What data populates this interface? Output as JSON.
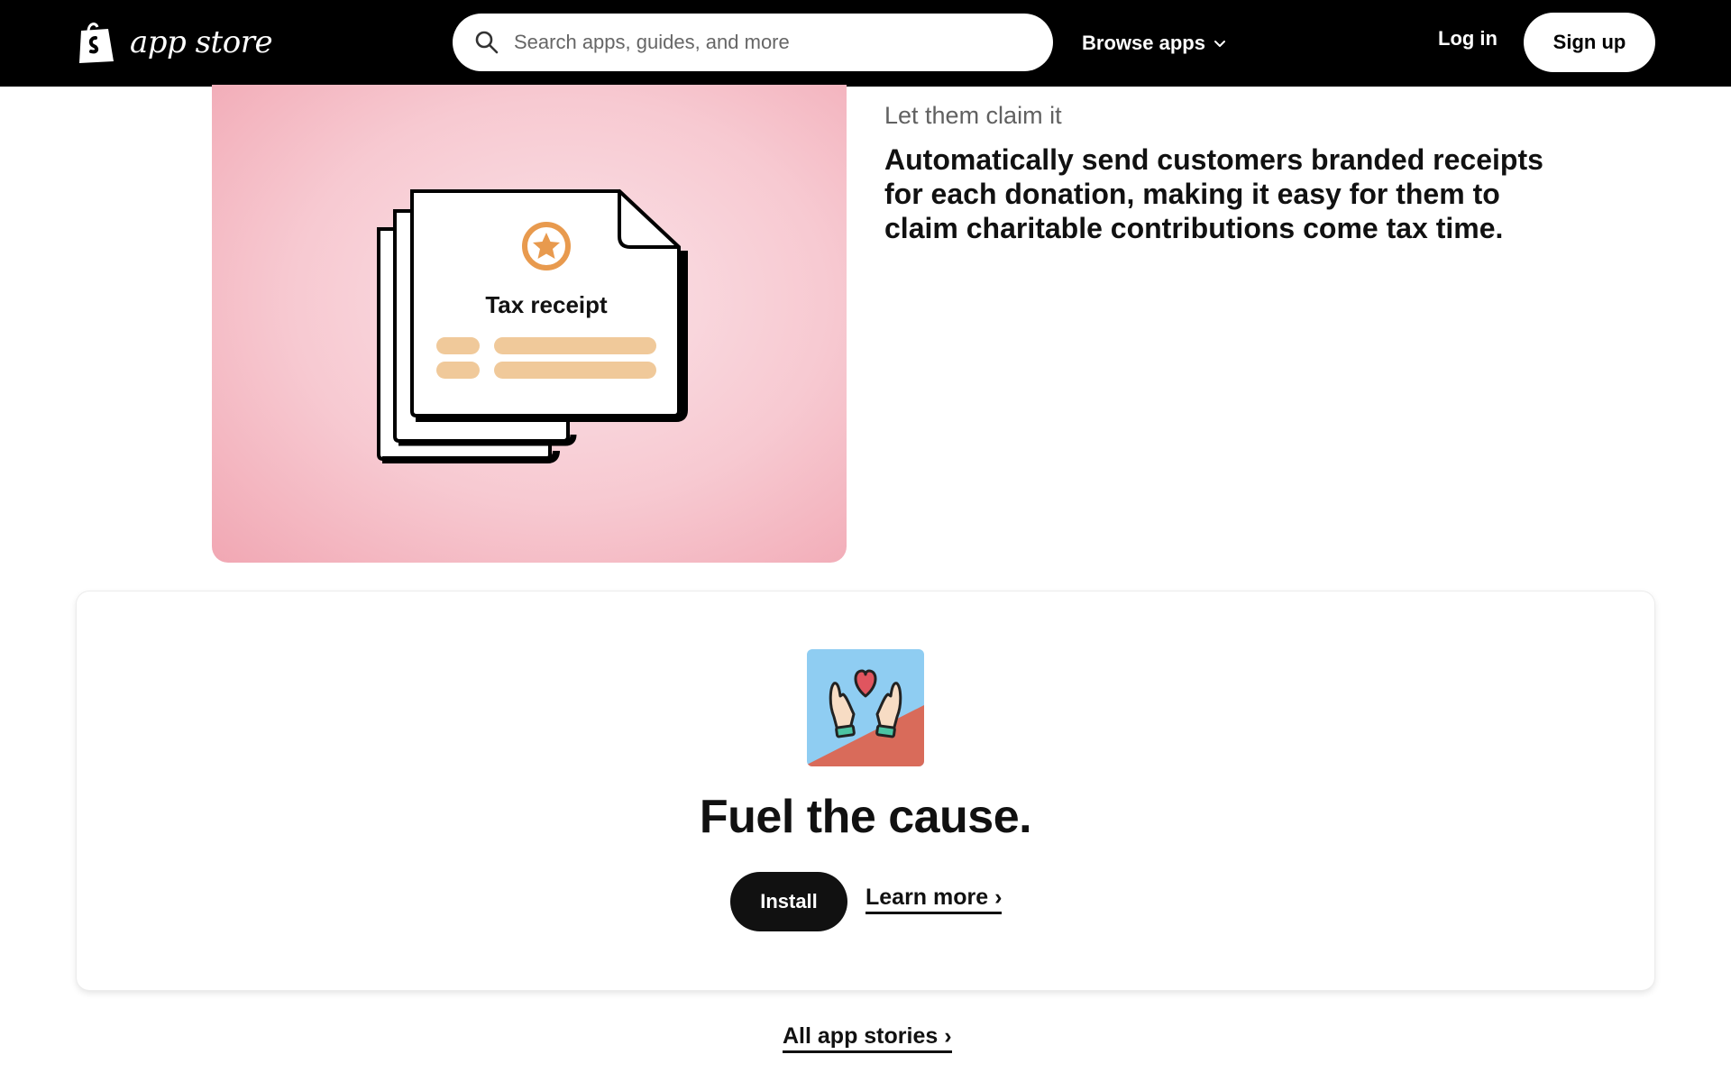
{
  "header": {
    "logo_text": "app store",
    "search_placeholder": "Search apps, guides, and more",
    "browse_label": "Browse apps",
    "login_label": "Log in",
    "signup_label": "Sign up"
  },
  "feature": {
    "illustration_label": "Tax receipt",
    "eyebrow": "Let them claim it",
    "heading": "Automatically send customers branded receipts for each donation, making it easy for them to claim charitable contributions come tax time."
  },
  "cta": {
    "title": "Fuel the cause.",
    "install_label": "Install",
    "learn_more_label": "Learn more ›"
  },
  "footer_link": "All app stories ›",
  "colors": {
    "nav_bg": "#000000",
    "feature_bg": "#f7c9d1",
    "receipt_accent": "#e89a4e",
    "receipt_lines": "#f0c99a",
    "icon_sky": "#8fcdf2",
    "icon_ground": "#d96b5a",
    "heart": "#e0555f"
  },
  "icons": [
    "shopify-bag-icon",
    "search-icon",
    "chevron-down-icon",
    "star-badge-icon",
    "hands-heart-icon"
  ]
}
